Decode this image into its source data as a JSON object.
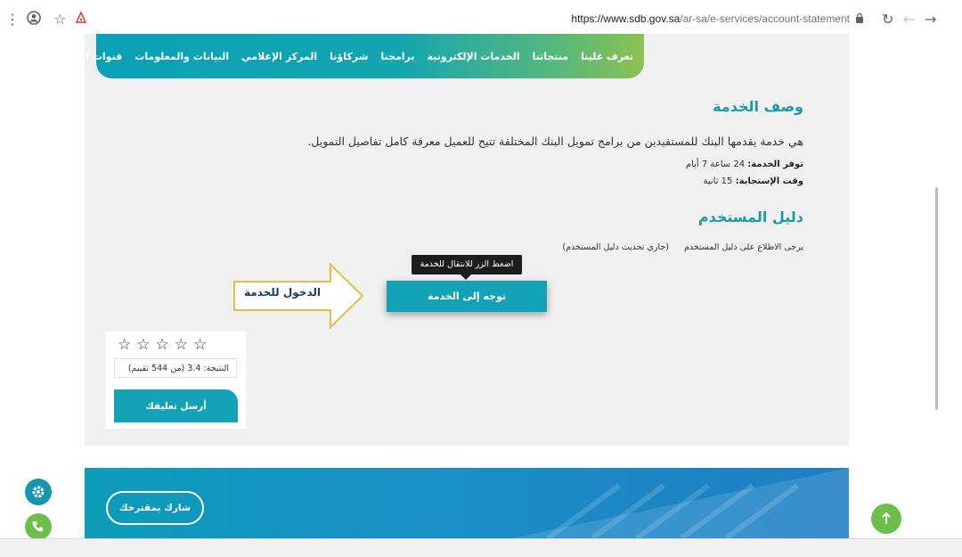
{
  "browser": {
    "url_host": "https://www.sdb.gov.sa",
    "url_path": "/ar-sa/e-services/account-statement"
  },
  "nav": {
    "items": [
      "تعرف علينا",
      "منتجاتنا",
      "الخدمات الإلكترونية",
      "برامجنا",
      "شركاؤنا",
      "المركز الإعلامي",
      "البيانات والمعلومات",
      "قنوات الاتصال"
    ]
  },
  "service": {
    "title": "وصف الخدمة",
    "description": "هي خدمة يقدمها البنك للمستفيدين من برامج تمويل البنك المختلفة تتيح للعميل معرفة كامل تفاصيل التمويل.",
    "availability_label": "توفر الخدمة:",
    "availability_value": "24 ساعة 7 أيام",
    "response_label": "وقت الإستجابة:",
    "response_value": "15 ثانية"
  },
  "guide": {
    "title": "دليل المستخدم",
    "text": "يرجى الاطلاع على دليل المستخدم",
    "link": "(جاري تحديث دليل المستخدم)"
  },
  "tooltip": "اضغط الزر للانتقال للخدمة",
  "go_button": "توجه إلى الخدمة",
  "arrow_label": "الدخول للخدمة",
  "rating": {
    "stars_total": 5,
    "score_text": "النتيجة: 3.4 (من 544 تقييم)",
    "feedback_button": "أرسل تعليقك"
  },
  "footer": {
    "suggest_button": "شارك بمقترحك"
  },
  "colors": {
    "brand_teal": "#14a2b6",
    "brand_green": "#8cc152",
    "settings_float": "#1496b0",
    "phone_float": "#6cbf4a",
    "top_float": "#6cbf4a"
  },
  "icons": {
    "settings_float": "gear-icon",
    "phone_float": "phone-icon",
    "top_float": "arrow-up-icon"
  }
}
